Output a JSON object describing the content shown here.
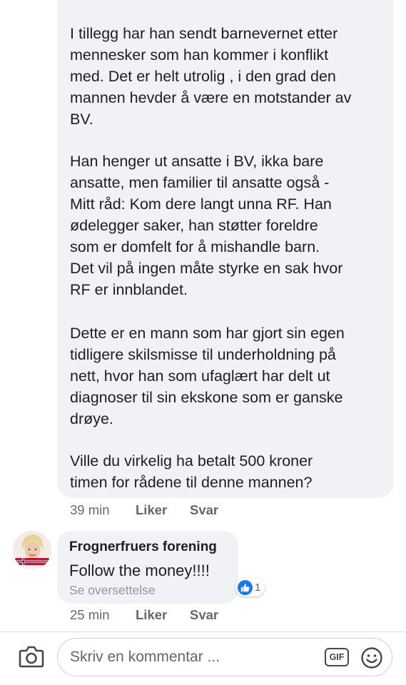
{
  "comment1": {
    "paragraphs": [
      "I tillegg har han sendt barnevernet etter\nmennesker som han kommer i konflikt\nmed. Det er helt utrolig , i den grad den\nmannen hevder å være en motstander av\nBV.",
      "Han henger ut ansatte i BV, ikka bare\nansatte, men familier til ansatte også -\nMitt råd: Kom dere langt unna RF. Han\nødelegger saker, han støtter foreldre\nsom er domfelt for å mishandle barn.\nDet vil på ingen måte styrke en sak hvor\nRF er innblandet.",
      "Dette er en mann som har gjort sin egen\ntidligere skilsmisse til underholdning på\nnett, hvor han som ufaglært har delt ut\ndiagnoser  til sin ekskone som er ganske\ndrøye.",
      "Ville du virkelig ha betalt 500 kroner\ntimen for rådene til denne mannen?"
    ],
    "time": "39 min",
    "like_label": "Liker",
    "reply_label": "Svar"
  },
  "comment2": {
    "author": "Frognerfruers forening",
    "text": "Follow the money!!!!",
    "translate_label": "Se oversettelse",
    "reaction": {
      "icon": "like-icon",
      "count": "1",
      "color": "#1877f2"
    },
    "time": "25 min",
    "like_label": "Liker",
    "reply_label": "Svar"
  },
  "composer": {
    "placeholder": "Skriv en kommentar ...",
    "gif_label": "GIF",
    "camera_icon": "camera-icon",
    "emoji_icon": "emoji-icon"
  }
}
